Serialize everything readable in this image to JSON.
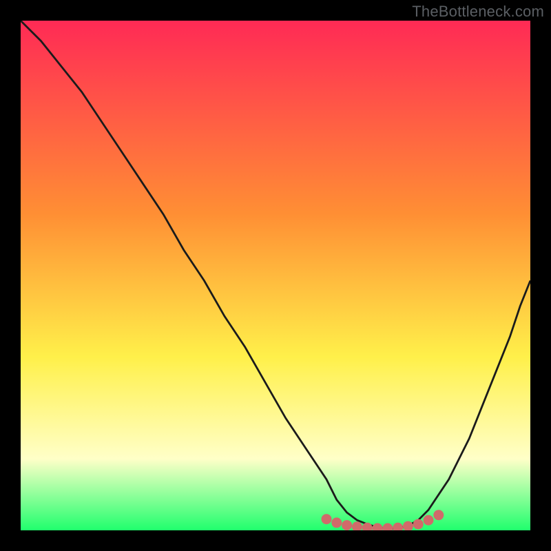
{
  "watermark": "TheBottleneck.com",
  "colors": {
    "frame": "#000000",
    "curve": "#1b1b1b",
    "marker_fill": "#d06a6a",
    "marker_stroke": "#d06a6a",
    "gradient_top": "#ff2a55",
    "gradient_mid1": "#ff8f34",
    "gradient_mid2": "#fff04a",
    "gradient_mid3": "#ffffc8",
    "gradient_bottom": "#20ff6d"
  },
  "chart_data": {
    "type": "line",
    "title": "",
    "xlabel": "",
    "ylabel": "",
    "xlim": [
      0,
      100
    ],
    "ylim": [
      0,
      100
    ],
    "grid": false,
    "legend": false,
    "series": [
      {
        "name": "bottleneck-curve",
        "x": [
          0,
          4,
          8,
          12,
          16,
          20,
          24,
          28,
          32,
          36,
          40,
          44,
          48,
          52,
          56,
          60,
          62,
          64,
          66,
          68,
          70,
          72,
          74,
          76,
          78,
          80,
          82,
          84,
          86,
          88,
          90,
          92,
          94,
          96,
          98,
          100
        ],
        "values": [
          100,
          96,
          91,
          86,
          80,
          74,
          68,
          62,
          55,
          49,
          42,
          36,
          29,
          22,
          16,
          10,
          6,
          3.5,
          2,
          1.2,
          0.6,
          0.3,
          0.4,
          0.9,
          2,
          4,
          7,
          10,
          14,
          18,
          23,
          28,
          33,
          38,
          44,
          49
        ]
      }
    ],
    "markers": {
      "name": "optimal-range-markers",
      "x": [
        60,
        62,
        64,
        66,
        68,
        70,
        72,
        74,
        76,
        78,
        80,
        82
      ],
      "values": [
        2.2,
        1.5,
        1.0,
        0.7,
        0.5,
        0.4,
        0.4,
        0.5,
        0.8,
        1.2,
        2.0,
        3.0
      ]
    }
  }
}
